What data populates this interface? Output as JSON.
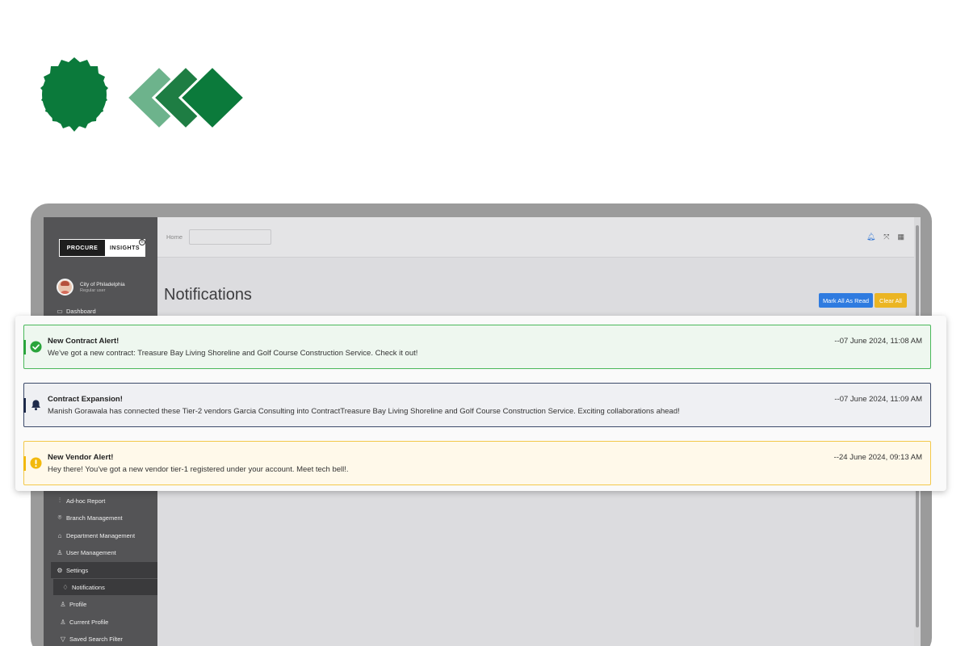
{
  "colors": {
    "brand_green": "#0b7a3b",
    "primary": "#2f7be0",
    "warning": "#ebb524",
    "sidebar": "#545456"
  },
  "brand": {
    "left": "PROCURE",
    "right": "INSIGHTS",
    "reg": "®"
  },
  "user": {
    "name": "City of Philadelphia",
    "role": "Regular user"
  },
  "sidebar": {
    "top_items": [
      {
        "label": "Dashboard",
        "icon": "monitor-icon"
      }
    ],
    "items": [
      {
        "label": "Ad-hoc Report",
        "icon": "sliders-icon"
      },
      {
        "label": "Branch Management",
        "icon": "map-pin-icon"
      },
      {
        "label": "Department Management",
        "icon": "building-icon"
      },
      {
        "label": "User Management",
        "icon": "user-icon"
      },
      {
        "label": "Settings",
        "icon": "gear-icon"
      },
      {
        "label": "Notifications",
        "icon": "bell-icon"
      },
      {
        "label": "Profile",
        "icon": "user-icon"
      },
      {
        "label": "Current Profile",
        "icon": "user-icon"
      },
      {
        "label": "Saved Search Filter",
        "icon": "filter-icon"
      }
    ]
  },
  "header": {
    "breadcrumb": "Home"
  },
  "page": {
    "title": "Notifications",
    "mark_all_label": "Mark All As Read",
    "clear_all_label": "Clear All"
  },
  "notifications": [
    {
      "type": "success",
      "icon": "check-circle-icon",
      "title": "New Contract Alert!",
      "message": "We've got a new contract: Treasure Bay Living Shoreline and Golf Course Construction Service. Check it out!",
      "time": "--07 June 2024, 11:08 AM"
    },
    {
      "type": "info",
      "icon": "bell-icon",
      "title": "Contract Expansion!",
      "message": "Manish Gorawala has connected these Tier-2 vendors Garcia Consulting into ContractTreasure Bay Living Shoreline and Golf Course Construction Service. Exciting collaborations ahead!",
      "time": "--07 June 2024, 11:09 AM"
    },
    {
      "type": "warning",
      "icon": "exclamation-circle-icon",
      "title": "New Vendor Alert!",
      "message": "Hey there! You've got a new vendor tier-1 registered under your account. Meet tech bell!.",
      "time": "--24 June 2024, 09:13 AM"
    }
  ]
}
